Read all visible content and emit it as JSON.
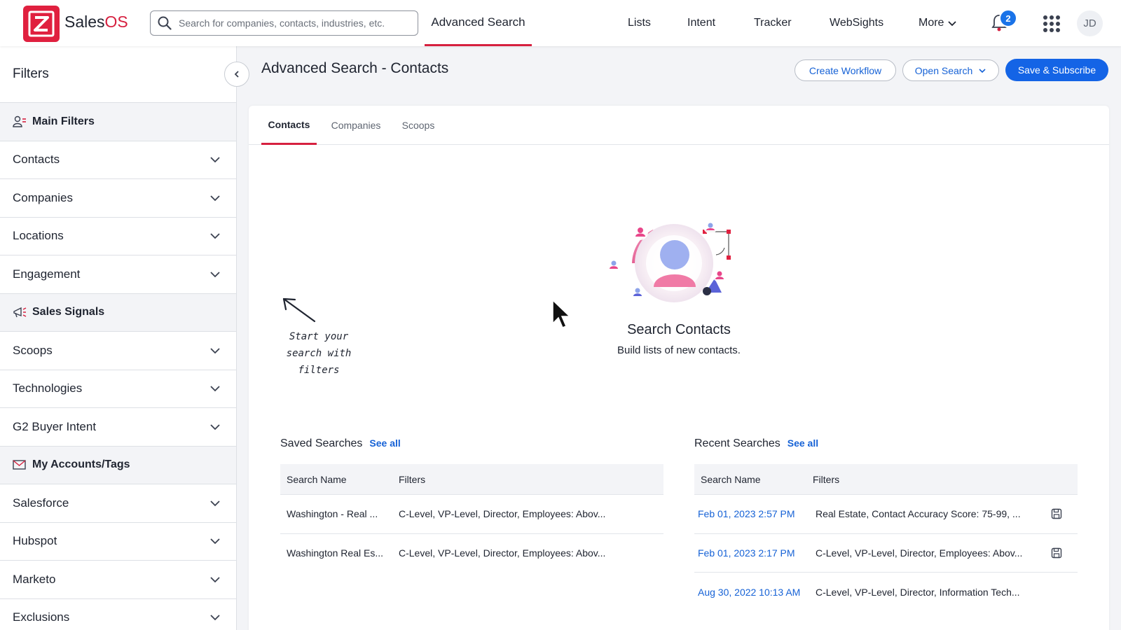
{
  "app": {
    "brand_main": "Sales",
    "brand_accent": "OS",
    "accent_color": "#d6203f",
    "primary_color": "#1464e6"
  },
  "header": {
    "search_placeholder": "Search for companies, contacts, industries, etc.",
    "active_nav": "Advanced Search",
    "nav": [
      "Lists",
      "Intent",
      "Tracker",
      "WebSights",
      "More"
    ],
    "notification_count": "2",
    "avatar_initials": "JD"
  },
  "sidebar": {
    "title": "Filters",
    "rows": [
      {
        "label": "Main Filters",
        "section": true,
        "icon": "user-filter-icon"
      },
      {
        "label": "Contacts"
      },
      {
        "label": "Companies"
      },
      {
        "label": "Locations"
      },
      {
        "label": "Engagement"
      },
      {
        "label": "Sales Signals",
        "section": true,
        "icon": "megaphone-icon"
      },
      {
        "label": "Scoops"
      },
      {
        "label": "Technologies"
      },
      {
        "label": "G2 Buyer Intent"
      },
      {
        "label": "My Accounts/Tags",
        "section": true,
        "icon": "tag-mail-icon"
      },
      {
        "label": "Salesforce"
      },
      {
        "label": "Hubspot"
      },
      {
        "label": "Marketo"
      },
      {
        "label": "Exclusions"
      }
    ]
  },
  "main": {
    "title": "Advanced Search - Contacts",
    "buttons": {
      "create_workflow": "Create Workflow",
      "open_search": "Open Search",
      "save_subscribe": "Save & Subscribe"
    },
    "tabs": [
      "Contacts",
      "Companies",
      "Scoops"
    ],
    "empty_state": {
      "title": "Search Contacts",
      "subtitle": "Build lists of new contacts."
    },
    "hint": "Start your search with filters"
  },
  "saved_searches": {
    "title": "Saved Searches",
    "see_all": "See all",
    "columns": [
      "Search Name",
      "Filters"
    ],
    "rows": [
      [
        "Washington - Real ...",
        "C-Level, VP-Level, Director, Employees: Abov..."
      ],
      [
        "Washington Real Es...",
        "C-Level, VP-Level, Director, Employees: Abov..."
      ]
    ]
  },
  "recent_searches": {
    "title": "Recent Searches",
    "see_all": "See all",
    "columns": [
      "Search Name",
      "Filters"
    ],
    "rows": [
      [
        "Feb 01, 2023 2:57 PM",
        "Real Estate, Contact Accuracy Score: 75-99, ..."
      ],
      [
        "Feb 01, 2023 2:17 PM",
        "C-Level, VP-Level, Director, Employees: Abov..."
      ],
      [
        "Aug 30, 2022 10:13 AM",
        "C-Level, VP-Level, Director, Information Tech..."
      ]
    ]
  }
}
